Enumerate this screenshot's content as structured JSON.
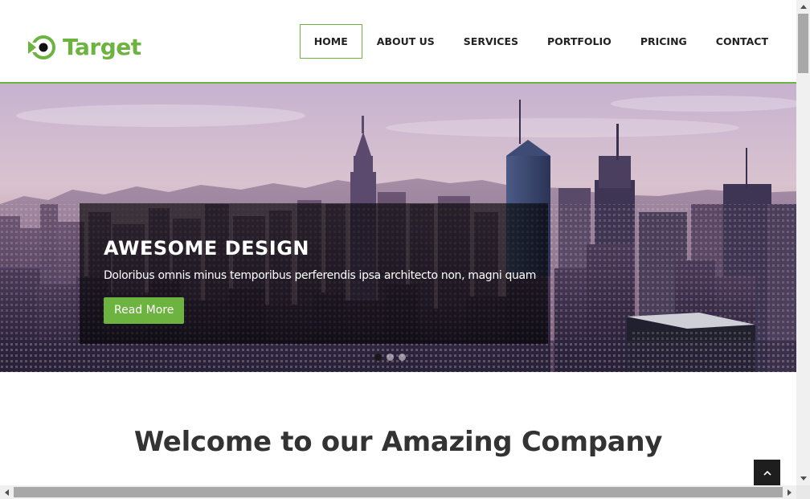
{
  "brand": {
    "name": "Target",
    "color": "#6db33f"
  },
  "nav": {
    "items": [
      {
        "label": "HOME",
        "active": true
      },
      {
        "label": "ABOUT US",
        "active": false
      },
      {
        "label": "SERVICES",
        "active": false
      },
      {
        "label": "PORTFOLIO",
        "active": false
      },
      {
        "label": "PRICING",
        "active": false
      },
      {
        "label": "CONTACT",
        "active": false
      }
    ]
  },
  "hero": {
    "title": "AWESOME DESIGN",
    "text": "Doloribus omnis minus temporibus perferendis ipsa architecto non, magni quam",
    "button_label": "Read More",
    "slides": 3,
    "active_slide": 1,
    "image": "city-skyline"
  },
  "welcome": {
    "heading": "Welcome to our Amazing Company"
  },
  "icons": {
    "back_to_top": "chevron-up-icon",
    "logo": "target-logo-icon"
  },
  "colors": {
    "accent": "#6db33f",
    "text_dark": "#333333",
    "caption_bg": "rgba(0,0,0,0.62)"
  }
}
